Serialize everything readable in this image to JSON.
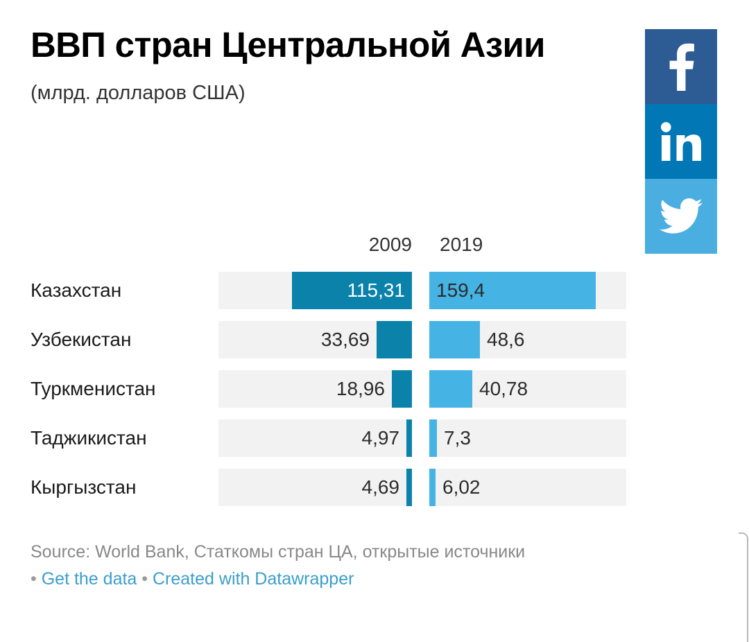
{
  "header": {
    "title": "ВВП стран Центральной Азии",
    "subtitle": "(млрд. долларов США)"
  },
  "social": {
    "facebook_label": "f",
    "linkedin_label": "in",
    "twitter_label": "twitter-bird",
    "facebook_color": "#2d5b94",
    "linkedin_color": "#0277b5",
    "twitter_color": "#4aaee0"
  },
  "footer": {
    "source": "Source: World Bank, Статкомы стран ЦА, открытые источники",
    "bullet": "•",
    "get_data_label": "Get the data",
    "created_with_label": "Created with Datawrapper"
  },
  "chart_data": {
    "type": "bar",
    "title": "ВВП стран Центральной Азии",
    "subtitle": "(млрд. долларов США)",
    "xlabel": "",
    "ylabel": "",
    "unit": "млрд. долларов США",
    "grid": false,
    "legend_position": "top",
    "orientation": "horizontal",
    "layout": "split-paired-columns",
    "categories": [
      "Казахстан",
      "Узбекистан",
      "Туркменистан",
      "Таджикистан",
      "Кыргызстан"
    ],
    "series": [
      {
        "name": "2009",
        "color": "#0a82aa",
        "align": "right",
        "values": [
          115.31,
          33.69,
          18.96,
          4.97,
          4.69
        ],
        "labels": [
          "115,31",
          "33,69",
          "18,96",
          "4,97",
          "4,69"
        ]
      },
      {
        "name": "2019",
        "color": "#45b3e4",
        "align": "left",
        "values": [
          159.4,
          48.6,
          40.78,
          7.3,
          6.02
        ],
        "labels": [
          "159,4",
          "48,6",
          "40,78",
          "7,3",
          "6,02"
        ]
      }
    ],
    "axis_max": 186,
    "track_color": "#f2f2f2"
  },
  "rows": [
    {
      "label": "Казахстан",
      "v2009": "115,31",
      "w2009": 173,
      "inside2009": true,
      "v2019": "159,4",
      "w2019": 240
    },
    {
      "label": "Узбекистан",
      "v2009": "33,69",
      "w2009": 51,
      "inside2009": false,
      "v2019": "48,6",
      "w2019": 73
    },
    {
      "label": "Туркменистан",
      "v2009": "18,96",
      "w2009": 29,
      "inside2009": false,
      "v2019": "40,78",
      "w2019": 62
    },
    {
      "label": "Таджикистан",
      "v2009": "4,97",
      "w2009": 8,
      "inside2009": false,
      "v2019": "7,3",
      "w2019": 11
    },
    {
      "label": "Кыргызстан",
      "v2009": "4,69",
      "w2009": 8,
      "inside2009": false,
      "v2019": "6,02",
      "w2019": 9
    }
  ],
  "columns": {
    "header_2009": "2009",
    "header_2019": "2019"
  }
}
